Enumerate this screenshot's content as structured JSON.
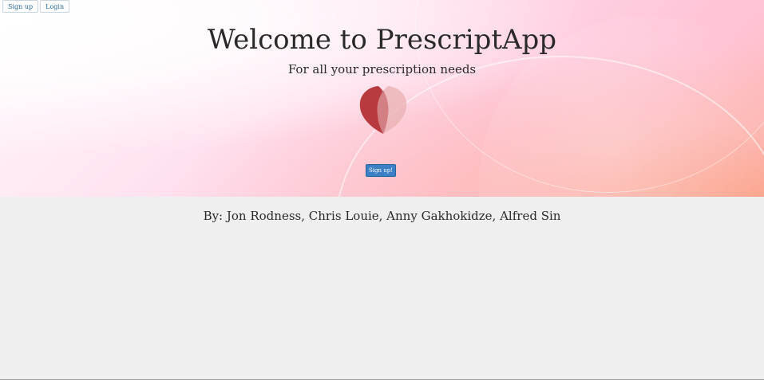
{
  "nav": {
    "signup_label": "Sign up",
    "login_label": "Login"
  },
  "hero": {
    "title": "Welcome to PrescriptApp",
    "subtitle": "For all your prescription needs",
    "cta_label": "Sign up!"
  },
  "footer": {
    "credits": "By: Jon Rodness, Chris Louie, Anny Gakhokidze, Alfred Sin"
  },
  "colors": {
    "primary_button": "#3b7fc4",
    "logo_left_petal": "#b22c30",
    "logo_right_petal": "#e8b8b8",
    "page_background": "#efefef"
  },
  "icons": {
    "logo": "leaf-heart-logo-icon"
  }
}
